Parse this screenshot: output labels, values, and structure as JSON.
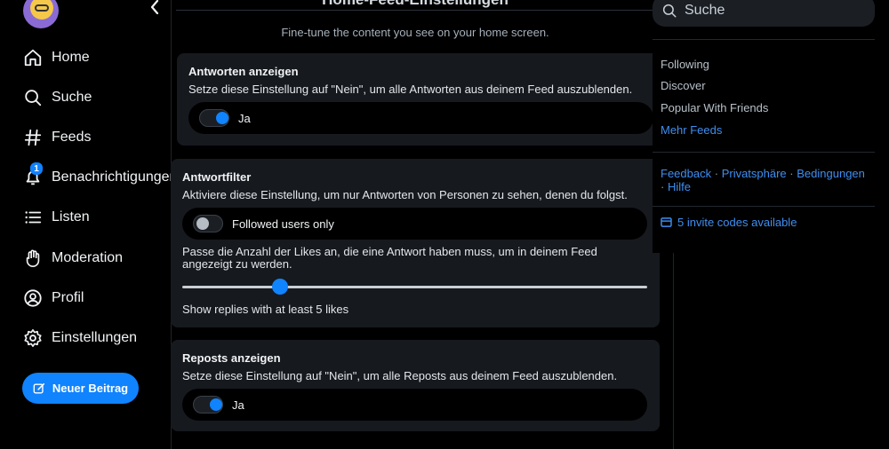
{
  "nav": {
    "items": [
      {
        "label": "Home",
        "icon": "home-icon"
      },
      {
        "label": "Suche",
        "icon": "search-icon"
      },
      {
        "label": "Feeds",
        "icon": "hash-icon"
      },
      {
        "label": "Benachrichtigungen",
        "icon": "bell-icon",
        "badge": "1"
      },
      {
        "label": "Listen",
        "icon": "list-icon"
      },
      {
        "label": "Moderation",
        "icon": "hand-icon"
      },
      {
        "label": "Profil",
        "icon": "user-icon"
      },
      {
        "label": "Einstellungen",
        "icon": "gear-icon"
      }
    ],
    "compose_label": "Neuer Beitrag"
  },
  "header": {
    "title": "Home-Feed-Einstellungen",
    "subtitle": "Fine-tune the content you see on your home screen."
  },
  "settings": {
    "replies": {
      "title": "Antworten anzeigen",
      "desc": "Setze diese Einstellung auf \"Nein\", um alle Antworten aus deinem Feed auszublenden.",
      "toggle_label": "Ja",
      "on": true
    },
    "reply_filter": {
      "title": "Antwortfilter",
      "desc": "Aktiviere diese Einstellung, um nur Antworten von Personen zu sehen, denen du folgst.",
      "toggle_label": "Followed users only",
      "on": false,
      "likes_desc": "Passe die Anzahl der Likes an, die eine Antwort haben muss, um in deinem Feed angezeigt zu werden.",
      "likes_value": 5,
      "likes_max": 25,
      "likes_label": "Show replies with at least 5 likes"
    },
    "reposts": {
      "title": "Reposts anzeigen",
      "desc": "Setze diese Einstellung auf \"Nein\", um alle Reposts aus deinem Feed auszublenden.",
      "toggle_label": "Ja",
      "on": true
    }
  },
  "sidebar": {
    "search_placeholder": "Suche",
    "feeds": [
      "Following",
      "Discover",
      "Popular With Friends"
    ],
    "more_feeds": "Mehr Feeds",
    "footer": {
      "feedback": "Feedback",
      "privacy": "Privatsphäre",
      "terms": "Bedingungen",
      "help": "Hilfe",
      "separator": "·"
    },
    "invite": "5 invite codes available"
  },
  "colors": {
    "accent": "#1083fe",
    "link": "#3f8ef0",
    "card": "#16191e",
    "background": "#000000"
  }
}
